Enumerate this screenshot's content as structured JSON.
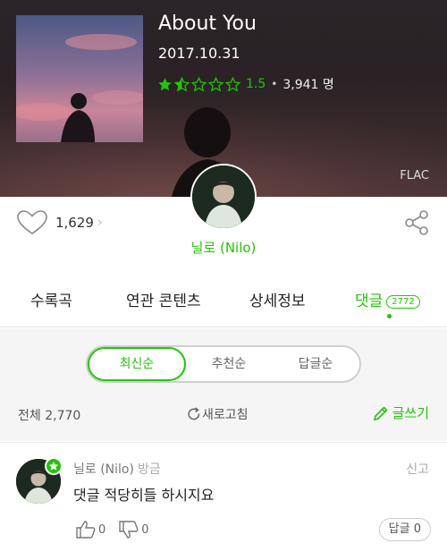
{
  "album": {
    "title": "About You",
    "release_date": "2017.10.31",
    "rating_score": "1.5",
    "rating_count": "3,941 명",
    "rating_stars": 1.5,
    "rating_max": 5,
    "format_badge": "FLAC"
  },
  "artist": {
    "name": "닐로 (Nilo)"
  },
  "like": {
    "count": "1,629",
    "arrow": "›"
  },
  "tabs": [
    {
      "label": "수록곡"
    },
    {
      "label": "연관 콘텐츠"
    },
    {
      "label": "상세정보"
    },
    {
      "label": "댓글",
      "badge": "2772"
    }
  ],
  "sort": {
    "options": [
      "최신순",
      "추천순",
      "답글순"
    ],
    "selected": "최신순"
  },
  "comments_header": {
    "total": "전체 2,770",
    "refresh": "새로고침",
    "write": "글쓰기"
  },
  "comment": {
    "author": "닐로 (Nilo)",
    "time": "방금",
    "report": "신고",
    "text": "댓글 적당히들 하시지요",
    "likes": "0",
    "dislikes": "0",
    "reply_label": "답글 0"
  },
  "colors": {
    "accent": "#1ec800",
    "header_bg": "#2a2225"
  },
  "icons": [
    "heart-icon",
    "share-icon",
    "refresh-icon",
    "pencil-icon",
    "thumbs-up-icon",
    "thumbs-down-icon",
    "star-icon"
  ]
}
